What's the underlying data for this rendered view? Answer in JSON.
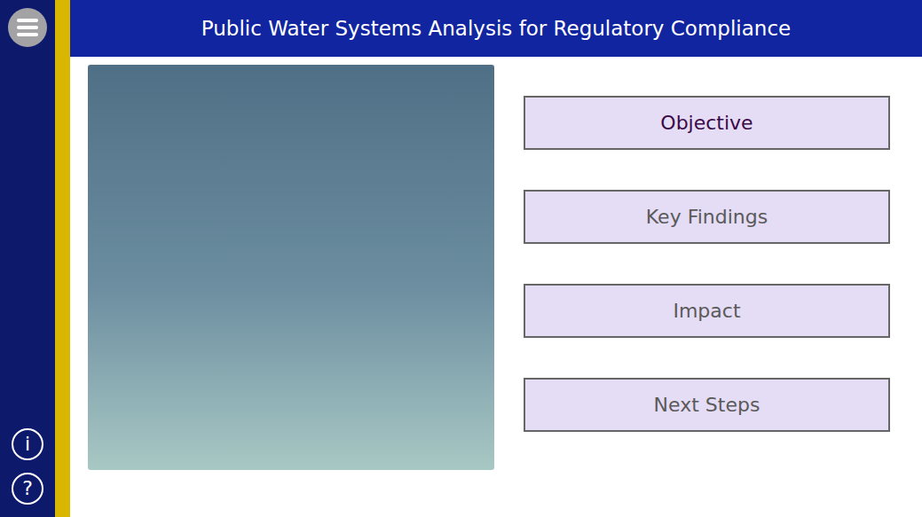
{
  "window": {
    "title": "Public Water Systems Analysis for Regulatory Compliance"
  },
  "sidebar": {
    "bottom_buttons": [
      {
        "label": "i",
        "name": "info"
      },
      {
        "label": "?",
        "name": "help"
      }
    ]
  },
  "nav_buttons": [
    {
      "label": "Objective",
      "selected": true
    },
    {
      "label": "Key Findings",
      "selected": false
    },
    {
      "label": "Impact",
      "selected": false
    },
    {
      "label": "Next Steps",
      "selected": false
    }
  ]
}
